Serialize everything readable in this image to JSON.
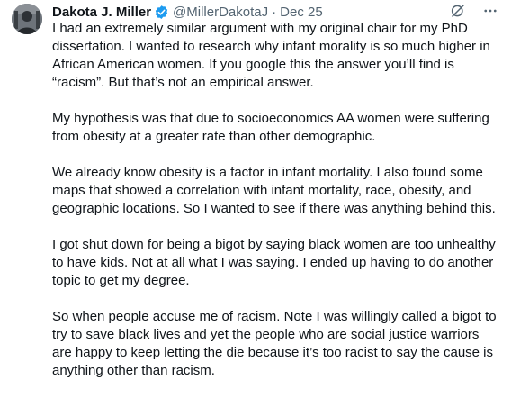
{
  "author": {
    "name": "Dakota J. Miller",
    "handle": "@MillerDakotaJ",
    "separator": "·",
    "date": "Dec 25"
  },
  "icons": {
    "avatar": "profile-photo",
    "verified": "verified-badge-icon",
    "grok": "grok-icon",
    "more": "more-options-icon",
    "accent": "#1d9bf0"
  },
  "paragraphs": [
    "I had an extremely similar argument with my original chair for my PhD dissertation. I wanted to research why infant morality is so much higher in African American women. If you google this the answer you’ll find is “racism”. But that’s not an empirical answer.",
    "My hypothesis was that due to socioeconomics AA women were suffering from obesity at a greater rate than other demographic.",
    "We already know obesity is a factor in infant mortality. I also found some maps that showed a correlation with infant mortality, race, obesity, and geographic locations. So I wanted to see if there was anything behind this.",
    "I got shut down for being a bigot by saying black women are too unhealthy to have kids. Not at all what I was saying. I ended up having to do another topic to get my degree.",
    "So when people accuse me of racism. Note I was willingly called a bigot to try to save black lives and yet the people who are social justice warriors are happy to keep letting the die because it’s too racist to say the cause is anything other than racism."
  ]
}
